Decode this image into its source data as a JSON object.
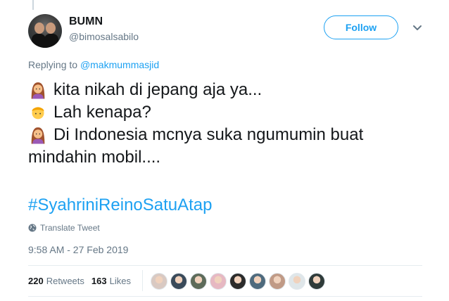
{
  "user": {
    "display_name": "BUMN",
    "handle": "@bimosalsabilo",
    "follow_label": "Follow"
  },
  "reply": {
    "prefix": "Replying to",
    "mention": "@makmummasjid"
  },
  "tweet": {
    "lines": [
      {
        "emoji": "woman-emoji",
        "text": "kita nikah di jepang aja ya..."
      },
      {
        "emoji": "man-emoji",
        "text": "Lah kenapa?"
      },
      {
        "emoji": "woman-emoji",
        "text": "Di Indonesia mcnya suka ngumumin buat"
      },
      {
        "emoji": "",
        "text": "mindahin mobil...."
      }
    ],
    "hashtag": "#SyahriniReinoSatuAtap"
  },
  "translate_label": "Translate Tweet",
  "timestamp": "9:58 AM - 27 Feb 2019",
  "stats": {
    "retweets_count": "220",
    "retweets_label": "Retweets",
    "likes_count": "163",
    "likes_label": "Likes"
  },
  "colors": {
    "accent": "#1da1f2",
    "secondary_text": "#657786",
    "primary_text": "#14171a"
  },
  "likers": [
    {
      "name": "liker-avatar-1",
      "color": "#d9c9c2"
    },
    {
      "name": "liker-avatar-2",
      "color": "#3a4a5a"
    },
    {
      "name": "liker-avatar-3",
      "color": "#5d6b5a"
    },
    {
      "name": "liker-avatar-4",
      "color": "#e6b8c2"
    },
    {
      "name": "liker-avatar-5",
      "color": "#2b2b2b"
    },
    {
      "name": "liker-avatar-6",
      "color": "#4e6a7d"
    },
    {
      "name": "liker-avatar-7",
      "color": "#c09a86"
    },
    {
      "name": "liker-avatar-8",
      "color": "#dfe6e9"
    },
    {
      "name": "liker-avatar-9",
      "color": "#2f3b3a"
    }
  ]
}
